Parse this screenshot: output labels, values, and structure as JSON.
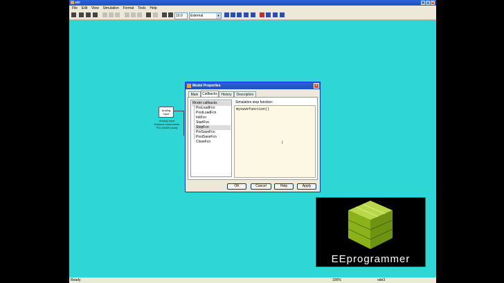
{
  "window": {
    "title": "adc"
  },
  "menu": [
    "File",
    "Edit",
    "View",
    "Simulation",
    "Format",
    "Tools",
    "Help"
  ],
  "toolbar": {
    "stop_time": "10.0",
    "sim_mode": "External"
  },
  "block": {
    "name": "Analog Input",
    "label": "Analog Input\nNational Instruments\nPCI-6036E [auto]"
  },
  "dialog": {
    "title": "Model Properties",
    "tabs": [
      "Main",
      "Callbacks",
      "History",
      "Description"
    ],
    "tree_root": "Model callbacks",
    "callbacks": [
      "PreLoadFcn",
      "PostLoadFcn",
      "InitFcn",
      "StartFcn",
      "StopFcn",
      "PreSaveFcn",
      "PostSaveFcn",
      "CloseFcn"
    ],
    "editor_label": "Simulation stop function:",
    "editor_value": "mysavefunction()",
    "buttons": {
      "ok": "OK",
      "cancel": "Cancel",
      "help": "Help",
      "apply": "Apply"
    }
  },
  "status": {
    "left": "Ready",
    "zoom": "100%",
    "solver": "ode3"
  },
  "logo": {
    "text": "EEprogrammer"
  },
  "colors": {
    "canvas": "#2fd6d6",
    "titlebar": "#1f4fc0",
    "logo_cube": "#9bc21c"
  }
}
